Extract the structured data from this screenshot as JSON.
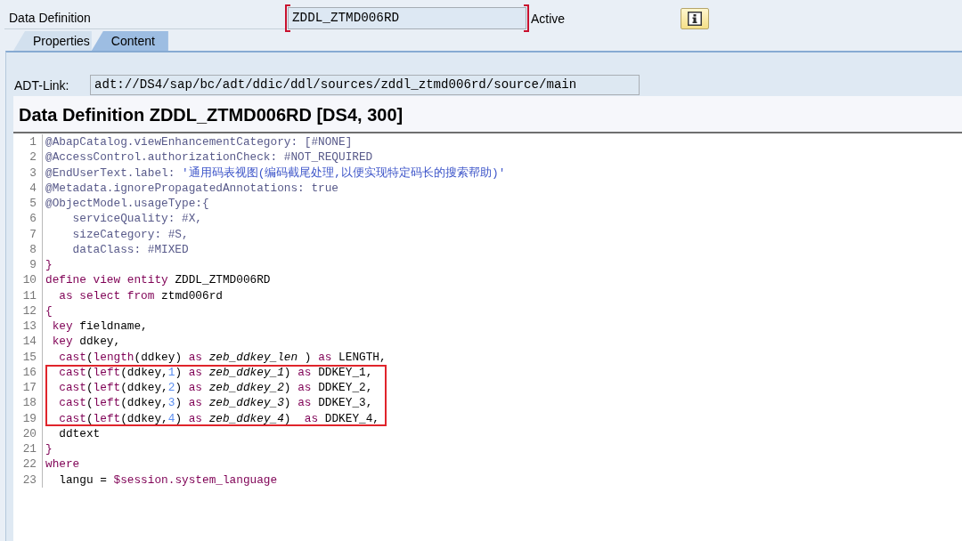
{
  "header": {
    "label": "Data Definition",
    "name_field": {
      "value": "ZDDL_ZTMD006RD",
      "required": true
    },
    "status": "Active"
  },
  "tabs": [
    {
      "label": "Properties",
      "selected": false
    },
    {
      "label": "Content",
      "selected": true
    }
  ],
  "adt_link": {
    "label": "ADT-Link:",
    "value": "adt://DS4/sap/bc/adt/ddic/ddl/sources/zddl_ztmd006rd/source/main"
  },
  "title": "Data Definition ZDDL_ZTMD006RD [DS4, 300]",
  "code": {
    "lines": [
      {
        "number": "1",
        "highlighted": false,
        "tokens": [
          {
            "kind": "annotation",
            "text": "@AbapCatalog.viewEnhancementCategory: [#NONE]"
          }
        ]
      },
      {
        "number": "2",
        "highlighted": false,
        "tokens": [
          {
            "kind": "annotation",
            "text": "@AccessControl.authorizationCheck: #NOT_REQUIRED"
          }
        ]
      },
      {
        "number": "3",
        "highlighted": false,
        "tokens": [
          {
            "kind": "annotation",
            "text": "@EndUserText.label: "
          },
          {
            "kind": "string",
            "text": "'通用码表视图(编码截尾处理,以便实现特定码长的搜索帮助)'"
          }
        ]
      },
      {
        "number": "4",
        "highlighted": false,
        "tokens": [
          {
            "kind": "annotation",
            "text": "@Metadata.ignorePropagatedAnnotations: true"
          }
        ]
      },
      {
        "number": "5",
        "highlighted": false,
        "tokens": [
          {
            "kind": "annotation",
            "text": "@ObjectModel.usageType:{"
          }
        ]
      },
      {
        "number": "6",
        "highlighted": false,
        "tokens": [
          {
            "kind": "annotation",
            "text": "    serviceQuality: #X,"
          }
        ]
      },
      {
        "number": "7",
        "highlighted": false,
        "tokens": [
          {
            "kind": "annotation",
            "text": "    sizeCategory: #S,"
          }
        ]
      },
      {
        "number": "8",
        "highlighted": false,
        "tokens": [
          {
            "kind": "annotation",
            "text": "    dataClass: #MIXED"
          }
        ]
      },
      {
        "number": "9",
        "highlighted": false,
        "tokens": [
          {
            "kind": "brace",
            "text": "}"
          }
        ]
      },
      {
        "number": "10",
        "highlighted": false,
        "tokens": [
          {
            "kind": "keyword",
            "text": "define view entity"
          },
          {
            "kind": "plain",
            "text": " ZDDL_ZTMD006RD"
          }
        ]
      },
      {
        "number": "11",
        "highlighted": false,
        "tokens": [
          {
            "kind": "keyword",
            "text": "  as select from"
          },
          {
            "kind": "plain",
            "text": " ztmd006rd"
          }
        ]
      },
      {
        "number": "12",
        "highlighted": false,
        "tokens": [
          {
            "kind": "brace",
            "text": "{"
          }
        ]
      },
      {
        "number": "13",
        "highlighted": false,
        "tokens": [
          {
            "kind": "keyword",
            "text": " key"
          },
          {
            "kind": "plain",
            "text": " fieldname,"
          }
        ]
      },
      {
        "number": "14",
        "highlighted": false,
        "tokens": [
          {
            "kind": "keyword",
            "text": " key"
          },
          {
            "kind": "plain",
            "text": " ddkey,"
          }
        ]
      },
      {
        "number": "15",
        "highlighted": false,
        "tokens": [
          {
            "kind": "keyword",
            "text": "  cast"
          },
          {
            "kind": "plain",
            "text": "("
          },
          {
            "kind": "keyword",
            "text": "length"
          },
          {
            "kind": "plain",
            "text": "(ddkey) "
          },
          {
            "kind": "keyword",
            "text": "as"
          },
          {
            "kind": "element",
            "text": " zeb_ddkey_len"
          },
          {
            "kind": "plain",
            "text": " ) "
          },
          {
            "kind": "keyword",
            "text": "as"
          },
          {
            "kind": "plain",
            "text": " LENGTH,"
          }
        ]
      },
      {
        "number": "16",
        "highlighted": true,
        "tokens": [
          {
            "kind": "keyword",
            "text": "  cast"
          },
          {
            "kind": "plain",
            "text": "("
          },
          {
            "kind": "keyword",
            "text": "left"
          },
          {
            "kind": "plain",
            "text": "(ddkey,"
          },
          {
            "kind": "number",
            "text": "1"
          },
          {
            "kind": "plain",
            "text": ") "
          },
          {
            "kind": "keyword",
            "text": "as"
          },
          {
            "kind": "element",
            "text": " zeb_ddkey_1"
          },
          {
            "kind": "plain",
            "text": ") "
          },
          {
            "kind": "keyword",
            "text": "as"
          },
          {
            "kind": "plain",
            "text": " DDKEY_1,"
          }
        ]
      },
      {
        "number": "17",
        "highlighted": true,
        "tokens": [
          {
            "kind": "keyword",
            "text": "  cast"
          },
          {
            "kind": "plain",
            "text": "("
          },
          {
            "kind": "keyword",
            "text": "left"
          },
          {
            "kind": "plain",
            "text": "(ddkey,"
          },
          {
            "kind": "number",
            "text": "2"
          },
          {
            "kind": "plain",
            "text": ") "
          },
          {
            "kind": "keyword",
            "text": "as"
          },
          {
            "kind": "element",
            "text": " zeb_ddkey_2"
          },
          {
            "kind": "plain",
            "text": ") "
          },
          {
            "kind": "keyword",
            "text": "as"
          },
          {
            "kind": "plain",
            "text": " DDKEY_2,"
          }
        ]
      },
      {
        "number": "18",
        "highlighted": true,
        "tokens": [
          {
            "kind": "keyword",
            "text": "  cast"
          },
          {
            "kind": "plain",
            "text": "("
          },
          {
            "kind": "keyword",
            "text": "left"
          },
          {
            "kind": "plain",
            "text": "(ddkey,"
          },
          {
            "kind": "number",
            "text": "3"
          },
          {
            "kind": "plain",
            "text": ") "
          },
          {
            "kind": "keyword",
            "text": "as"
          },
          {
            "kind": "element",
            "text": " zeb_ddkey_3"
          },
          {
            "kind": "plain",
            "text": ") "
          },
          {
            "kind": "keyword",
            "text": "as"
          },
          {
            "kind": "plain",
            "text": " DDKEY_3,"
          }
        ]
      },
      {
        "number": "19",
        "highlighted": true,
        "tokens": [
          {
            "kind": "keyword",
            "text": "  cast"
          },
          {
            "kind": "plain",
            "text": "("
          },
          {
            "kind": "keyword",
            "text": "left"
          },
          {
            "kind": "plain",
            "text": "(ddkey,"
          },
          {
            "kind": "number",
            "text": "4"
          },
          {
            "kind": "plain",
            "text": ") "
          },
          {
            "kind": "keyword",
            "text": "as"
          },
          {
            "kind": "element",
            "text": " zeb_ddkey_4"
          },
          {
            "kind": "plain",
            "text": ")  "
          },
          {
            "kind": "keyword",
            "text": "as"
          },
          {
            "kind": "plain",
            "text": " DDKEY_4,"
          }
        ]
      },
      {
        "number": "20",
        "highlighted": false,
        "tokens": [
          {
            "kind": "plain",
            "text": "  ddtext"
          }
        ]
      },
      {
        "number": "21",
        "highlighted": false,
        "tokens": [
          {
            "kind": "brace",
            "text": "}"
          }
        ]
      },
      {
        "number": "22",
        "highlighted": false,
        "tokens": [
          {
            "kind": "keyword",
            "text": "where"
          }
        ]
      },
      {
        "number": "23",
        "highlighted": false,
        "tokens": [
          {
            "kind": "plain",
            "text": "  langu = "
          },
          {
            "kind": "keyword",
            "text": "$session.system_language"
          }
        ]
      }
    ]
  }
}
